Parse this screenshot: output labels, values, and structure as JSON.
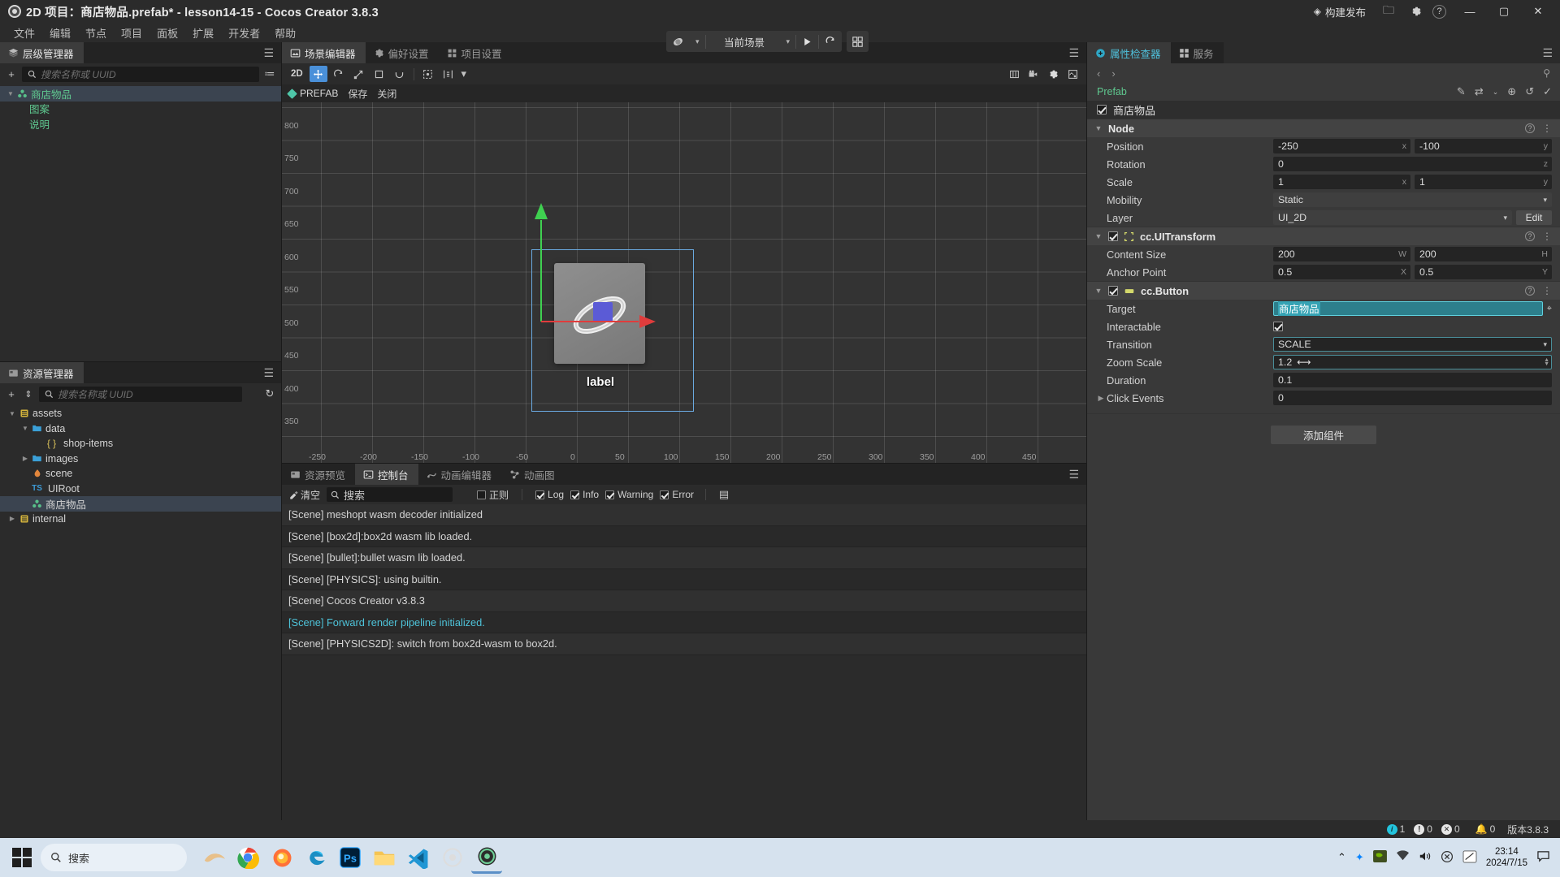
{
  "titlebar": {
    "title": "2D 项目：商店物品.prefab* - lesson14-15 - Cocos Creator 3.8.3",
    "minimize": "—",
    "maximize": "▢",
    "close": "✕"
  },
  "menubar": {
    "items": [
      "文件",
      "编辑",
      "节点",
      "项目",
      "面板",
      "扩展",
      "开发者",
      "帮助"
    ]
  },
  "playbar": {
    "preview_target": "浏览器",
    "scene_mode": "当前场景",
    "play": "▶",
    "refresh": "↺",
    "device": "▦",
    "build_label": "构建发布",
    "folder": "📁",
    "settings": "⚙",
    "help": "?"
  },
  "hierarchy": {
    "tab": "层级管理器",
    "search_placeholder": "搜索名称或 UUID",
    "add": "+",
    "filter": "≔",
    "menu": "☰",
    "nodes": [
      {
        "label": "商店物品",
        "indent": 0,
        "twisty": "v",
        "icon": "prefab-icon",
        "color": "green",
        "selected": true
      },
      {
        "label": "图案",
        "indent": 1,
        "twisty": "",
        "icon": "",
        "color": "green",
        "selected": false
      },
      {
        "label": "说明",
        "indent": 1,
        "twisty": "",
        "icon": "",
        "color": "green",
        "selected": false
      }
    ]
  },
  "assets": {
    "tab": "资源管理器",
    "search_placeholder": "搜索名称或 UUID",
    "add": "+",
    "sort": "⇕",
    "refresh": "↻",
    "menu": "☰",
    "nodes": [
      {
        "label": "assets",
        "indent": 0,
        "twisty": "v",
        "icon": "db-icon",
        "color": "white",
        "selected": false
      },
      {
        "label": "data",
        "indent": 1,
        "twisty": "v",
        "icon": "folder-icon",
        "color": "white",
        "selected": false
      },
      {
        "label": "shop-items",
        "indent": 2,
        "twisty": "",
        "icon": "json-icon",
        "color": "white",
        "selected": false
      },
      {
        "label": "images",
        "indent": 1,
        "twisty": ">",
        "icon": "folder-icon",
        "color": "white",
        "selected": false
      },
      {
        "label": "scene",
        "indent": 1,
        "twisty": "",
        "icon": "scene-icon",
        "color": "white",
        "selected": false
      },
      {
        "label": "UIRoot",
        "indent": 1,
        "twisty": "",
        "icon": "ts-icon",
        "color": "white",
        "selected": false
      },
      {
        "label": "商店物品",
        "indent": 1,
        "twisty": "",
        "icon": "prefab-icon",
        "color": "white",
        "selected": true
      },
      {
        "label": "internal",
        "indent": 0,
        "twisty": ">",
        "icon": "db-icon",
        "color": "white",
        "selected": false
      }
    ]
  },
  "scene": {
    "tabs": [
      {
        "label": "场景编辑器",
        "icon": "scene-icon",
        "active": true
      },
      {
        "label": "偏好设置",
        "icon": "gear-icon",
        "active": false
      },
      {
        "label": "项目设置",
        "icon": "project-icon",
        "active": false
      }
    ],
    "menu": "☰",
    "toolbar": {
      "mode_2d": "2D",
      "move": "✛",
      "rotate": "⟳",
      "scale": "⤢",
      "rect": "▭",
      "arc": "◡",
      "pivot": "⊹",
      "align": "⊪",
      "view_icons": [
        "▣",
        "🗖",
        "⚙",
        "⛶"
      ]
    },
    "prefab_bar": {
      "tag": "PREFAB",
      "save": "保存",
      "close": "关闭"
    },
    "ruler_y": [
      "800",
      "750",
      "700",
      "650",
      "600",
      "550",
      "500",
      "450",
      "400",
      "350"
    ],
    "ruler_x": [
      "-250",
      "-200",
      "-150",
      "-100",
      "-50",
      "0",
      "50",
      "100",
      "150",
      "200",
      "250",
      "300",
      "350",
      "400",
      "450"
    ],
    "label_text": "label"
  },
  "console": {
    "tabs": [
      {
        "label": "资源预览",
        "icon": "preview-icon",
        "active": false
      },
      {
        "label": "控制台",
        "icon": "console-icon",
        "active": true
      },
      {
        "label": "动画编辑器",
        "icon": "anim-icon",
        "active": false
      },
      {
        "label": "动画图",
        "icon": "animgraph-icon",
        "active": false
      }
    ],
    "menu": "☰",
    "clear_label": "清空",
    "search_placeholder": "搜索",
    "regex_label": "正则",
    "filters": [
      {
        "label": "Log",
        "checked": true
      },
      {
        "label": "Info",
        "checked": true
      },
      {
        "label": "Warning",
        "checked": true
      },
      {
        "label": "Error",
        "checked": true
      }
    ],
    "detail_icon": "▤",
    "messages": [
      {
        "text": "[Scene] meshopt wasm decoder initialized",
        "highlight": false
      },
      {
        "text": "[Scene] [box2d]:box2d wasm lib loaded.",
        "highlight": false
      },
      {
        "text": "[Scene] [bullet]:bullet wasm lib loaded.",
        "highlight": false
      },
      {
        "text": "[Scene] [PHYSICS]: using builtin.",
        "highlight": false
      },
      {
        "text": "[Scene] Cocos Creator v3.8.3",
        "highlight": false
      },
      {
        "text": "[Scene] Forward render pipeline initialized.",
        "highlight": true
      },
      {
        "text": "[Scene] [PHYSICS2D]: switch from box2d-wasm to box2d.",
        "highlight": false
      }
    ]
  },
  "inspector": {
    "tabs": [
      {
        "label": "属性检查器",
        "icon": "inspector-icon",
        "active": true
      },
      {
        "label": "服务",
        "icon": "services-icon",
        "active": false
      }
    ],
    "menu": "☰",
    "nav_back": "‹",
    "nav_forward": "›",
    "pin": "⚲",
    "prefab_label": "Prefab",
    "prefab_icons": [
      "✎",
      "⇄",
      "⌄",
      "⊕",
      "↺",
      "✓"
    ],
    "node_name": "商店物品",
    "components": [
      {
        "name": "Node",
        "icon": "",
        "has_checkbox": false,
        "properties": [
          {
            "label": "Position",
            "type": "vec2",
            "values": [
              "-250",
              "-100"
            ],
            "axes": [
              "x",
              "y"
            ]
          },
          {
            "label": "Rotation",
            "type": "single",
            "values": [
              "0"
            ],
            "axes": [
              "z"
            ]
          },
          {
            "label": "Scale",
            "type": "vec2",
            "values": [
              "1",
              "1"
            ],
            "axes": [
              "x",
              "y"
            ]
          },
          {
            "label": "Mobility",
            "type": "dropdown",
            "values": [
              "Static"
            ],
            "axes": []
          },
          {
            "label": "Layer",
            "type": "dropdown-edit",
            "values": [
              "UI_2D"
            ],
            "axes": [],
            "button": "Edit"
          }
        ]
      },
      {
        "name": "cc.UITransform",
        "icon": "uitransform-icon",
        "has_checkbox": true,
        "properties": [
          {
            "label": "Content Size",
            "type": "vec2",
            "values": [
              "200",
              "200"
            ],
            "axes": [
              "W",
              "H"
            ]
          },
          {
            "label": "Anchor Point",
            "type": "vec2",
            "values": [
              "0.5",
              "0.5"
            ],
            "axes": [
              "X",
              "Y"
            ]
          }
        ]
      },
      {
        "name": "cc.Button",
        "icon": "button-icon",
        "has_checkbox": true,
        "properties": [
          {
            "label": "Target",
            "type": "node-ref-selected",
            "values": [
              "商店物品"
            ],
            "axes": []
          },
          {
            "label": "Interactable",
            "type": "checkbox",
            "values": [
              ""
            ],
            "axes": []
          },
          {
            "label": "Transition",
            "type": "dropdown-teal",
            "values": [
              "SCALE"
            ],
            "axes": []
          },
          {
            "label": "Zoom Scale",
            "type": "number-drag",
            "values": [
              "1.2"
            ],
            "axes": []
          },
          {
            "label": "Duration",
            "type": "single",
            "values": [
              "0.1"
            ],
            "axes": []
          },
          {
            "label": "Click Events",
            "type": "array",
            "values": [
              "0"
            ],
            "axes": [],
            "twisty": ">"
          }
        ]
      }
    ],
    "add_component": "添加组件"
  },
  "statusbar": {
    "info_count": "1",
    "warn_count": "0",
    "error_count": "0",
    "bell_count": "0",
    "version": "版本3.8.3"
  },
  "taskbar": {
    "search_placeholder": "搜索",
    "time": "23:14",
    "date": "2024/7/15"
  }
}
